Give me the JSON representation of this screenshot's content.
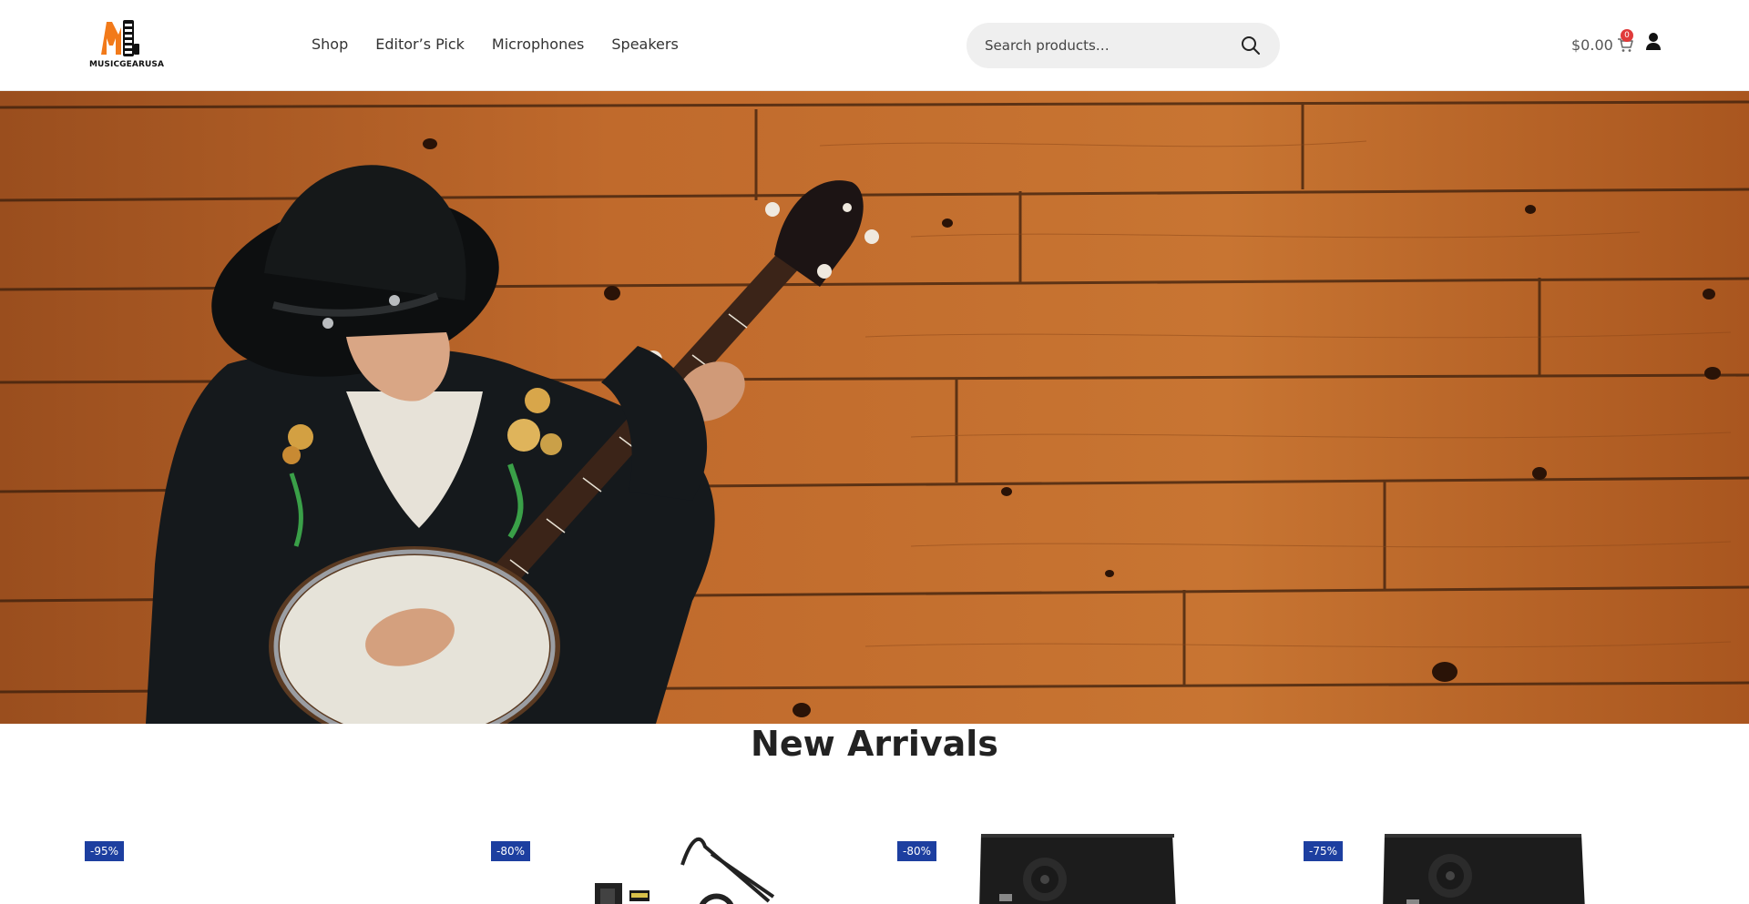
{
  "brand": {
    "name": "MUSICGEARUSA",
    "accent": "#f27a1a"
  },
  "nav": {
    "items": [
      {
        "label": "Shop"
      },
      {
        "label": "Editor’s Pick"
      },
      {
        "label": "Microphones"
      },
      {
        "label": "Speakers"
      }
    ]
  },
  "search": {
    "placeholder": "Search products…",
    "icon": "search-icon"
  },
  "cart": {
    "total": "$0.00",
    "count": "0",
    "icon": "cart-icon",
    "badge_color": "#e03a3a"
  },
  "account": {
    "icon": "user-icon"
  },
  "hero": {
    "image": "banjo player against wooden wall"
  },
  "new_arrivals": {
    "title": "New Arrivals",
    "products": [
      {
        "discount": "-95%"
      },
      {
        "discount": "-80%"
      },
      {
        "discount": "-80%"
      },
      {
        "discount": "-75%"
      }
    ]
  },
  "colors": {
    "badge": "#1d3fa0",
    "search_bg": "#efefef"
  }
}
